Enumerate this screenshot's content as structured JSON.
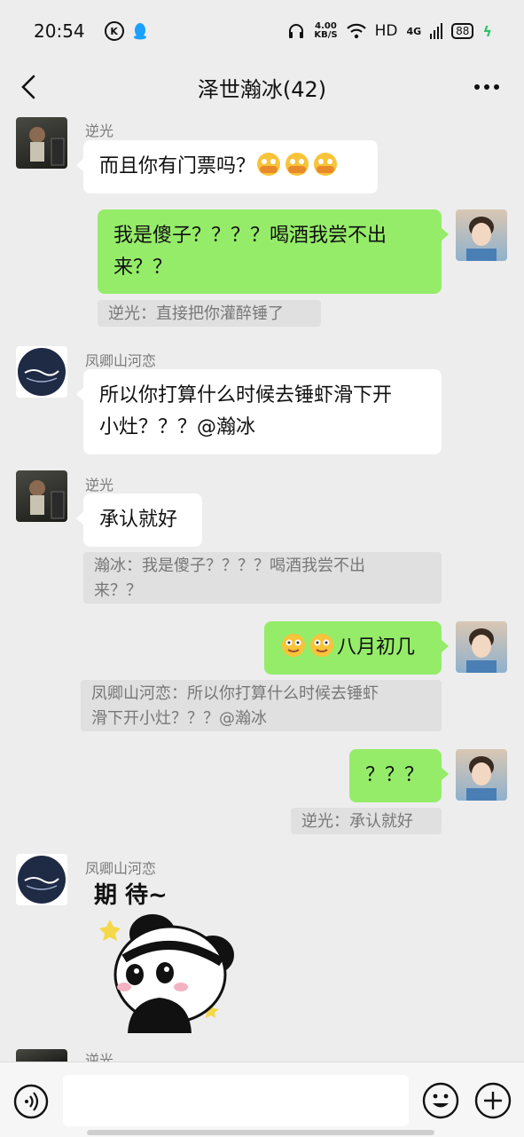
{
  "status": {
    "time": "20:54",
    "speed_value": "4.00",
    "speed_unit": "KB/S",
    "hd": "HD",
    "network": "4G",
    "battery": "88"
  },
  "header": {
    "title": "泽世瀚冰(42)"
  },
  "messages": [
    {
      "sender": "逆光",
      "text": "而且你有门票吗？"
    },
    {
      "text_line1": "我是傻子？？？？喝酒我尝不出",
      "text_line2": "来？？",
      "quote": "逆光：直接把你灌醉锤了"
    },
    {
      "sender": "凤卿山河恋",
      "text_line1": "所以你打算什么时候去锤虾滑下开",
      "text_line2": "小灶？？？@瀚冰"
    },
    {
      "sender": "逆光",
      "text": "承认就好",
      "quote_line1": "瀚冰：我是傻子？？？？喝酒我尝不出",
      "quote_line2": "来？？"
    },
    {
      "text": "八月初几",
      "quote_line1": "凤卿山河恋：所以你打算什么时候去锤虾",
      "quote_line2": "滑下开小灶？？？@瀚冰"
    },
    {
      "text": "？？？",
      "quote": "逆光：承认就好"
    },
    {
      "sender": "凤卿山河恋",
      "sticker_text": "期 待~"
    },
    {
      "sender": "逆光"
    }
  ],
  "icons": [
    "back-icon",
    "more-icon",
    "voice-icon",
    "emoji-icon",
    "plus-icon"
  ]
}
